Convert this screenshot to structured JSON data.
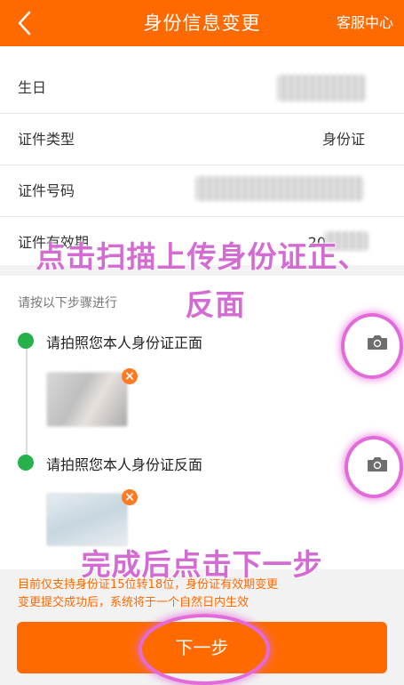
{
  "header": {
    "title": "身份信息变更",
    "right_label": "客服中心",
    "back_icon": "chevron-left-icon"
  },
  "info_rows": [
    {
      "label": "生日",
      "value": ""
    },
    {
      "label": "证件类型",
      "value": "身份证"
    },
    {
      "label": "证件号码",
      "value": ""
    },
    {
      "label": "证件有效期",
      "value": "20"
    }
  ],
  "steps": {
    "hint": "请按以下步骤进行",
    "items": [
      {
        "text": "请拍照您本人身份证正面",
        "camera_icon": "camera-icon"
      },
      {
        "text": "请拍照您本人身份证反面",
        "camera_icon": "camera-icon"
      }
    ],
    "remove_symbol": "×"
  },
  "notice": [
    "目前仅支持身份证15位转18位，身份证有效期变更",
    "变更提交成功后，系统将于一个自然日内生效"
  ],
  "next_button": "下一步",
  "overlays": {
    "upload_hint_line1": "点击扫描上传身份证正、",
    "upload_hint_line2": "反面",
    "complete_hint": "完成后点击下一步"
  },
  "colors": {
    "accent": "#ff6a00",
    "step_dot": "#27b14a",
    "annotation": "#e36ad9"
  }
}
